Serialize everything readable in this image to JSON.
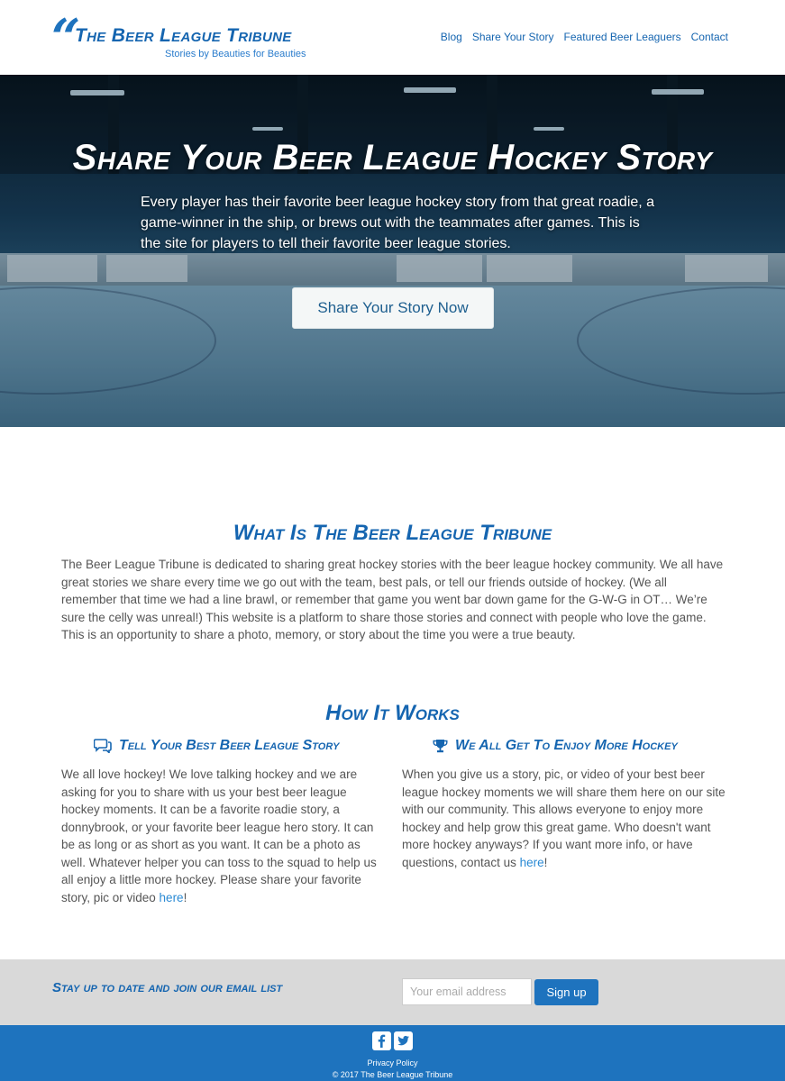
{
  "brand": {
    "title": "The Beer League Tribune",
    "tagline": "Stories by Beauties for Beauties",
    "accent_color": "#1e73be"
  },
  "nav": {
    "items": [
      "Blog",
      "Share Your Story",
      "Featured Beer Leaguers",
      "Contact"
    ]
  },
  "hero": {
    "title": "Share Your Beer League Hockey Story",
    "text": "Every player has their favorite beer league hockey story from that great roadie, a game-winner in the ship, or brews out with the teammates after games. This is the site for players to tell their favorite beer league stories.",
    "button_label": "Share Your Story Now"
  },
  "about": {
    "title": "What Is The Beer League Tribune",
    "text": "The Beer League Tribune is dedicated to sharing great hockey stories with the beer league hockey community. We all have great stories we share every time we go out with the team, best pals, or tell our friends outside of hockey. (We all remember that time we had a line brawl, or remember that game you went bar down game for the G-W-G in OT… We’re sure the celly was unreal!) This website is a platform to share those stories and connect with people who love the game. This is an opportunity to share a photo, memory, or story about the time you were a true beauty."
  },
  "how": {
    "title": "How It Works",
    "left": {
      "icon": "comments-icon",
      "heading": "Tell Your Best Beer League Story",
      "text": "We all love hockey! We love talking hockey and we are asking for you to share with us your best beer league hockey moments. It can be a favorite roadie story, a donnybrook, or your favorite beer league hero story. It can be as long or as short as you want. It can be a photo as well. Whatever helper you can toss to the squad to help us all enjoy a little more hockey. Please share your favorite story, pic or video ",
      "link": "here",
      "after": "!"
    },
    "right": {
      "icon": "trophy-icon",
      "heading": "We All Get To Enjoy More Hockey",
      "text": "When you give us a story, pic, or video of your best beer league hockey moments we will share them here on our site with our community. This allows everyone to enjoy more hockey and help grow this great game. Who doesn't want more hockey anyways? If you want more info, or have questions, contact us ",
      "link": "here",
      "after": "!"
    }
  },
  "newsletter": {
    "label": "Stay up to date and join our email list",
    "placeholder": "Your email address",
    "button_label": "Sign up"
  },
  "footer": {
    "social": [
      "facebook-icon",
      "twitter-icon"
    ],
    "privacy_label": "Privacy Policy",
    "copyright": "© 2017 The Beer League Tribune"
  }
}
